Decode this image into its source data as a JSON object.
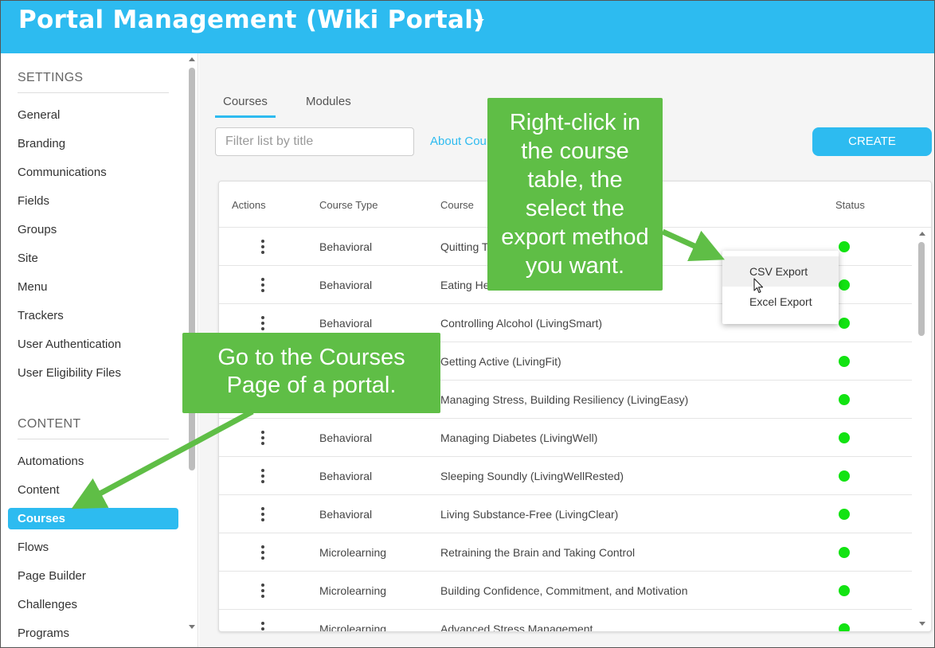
{
  "header": {
    "title": "Portal Management (Wiki Portal)",
    "bg_color": "#2dbbf0"
  },
  "sidebar": {
    "settings_heading": "SETTINGS",
    "settings_items": [
      {
        "label": "General"
      },
      {
        "label": "Branding"
      },
      {
        "label": "Communications"
      },
      {
        "label": "Fields"
      },
      {
        "label": "Groups"
      },
      {
        "label": "Site"
      },
      {
        "label": "Menu"
      },
      {
        "label": "Trackers"
      },
      {
        "label": "User Authentication"
      },
      {
        "label": "User Eligibility Files"
      }
    ],
    "content_heading": "CONTENT",
    "content_items": [
      {
        "label": "Automations"
      },
      {
        "label": "Content"
      },
      {
        "label": "Courses",
        "active": true
      },
      {
        "label": "Flows"
      },
      {
        "label": "Page Builder"
      },
      {
        "label": "Challenges"
      },
      {
        "label": "Programs"
      }
    ]
  },
  "main": {
    "tabs": [
      {
        "label": "Courses",
        "active": true
      },
      {
        "label": "Modules"
      }
    ],
    "filter": {
      "placeholder": "Filter list by title"
    },
    "about_link": "About Cou",
    "create_label": "CREATE"
  },
  "table": {
    "headers": {
      "actions": "Actions",
      "course_type": "Course Type",
      "course": "Course",
      "status": "Status"
    },
    "rows": [
      {
        "type": "Behavioral",
        "course": "Quitting T",
        "status_color": "#12e312"
      },
      {
        "type": "Behavioral",
        "course": "Eating He",
        "status_color": "#12e312"
      },
      {
        "type": "Behavioral",
        "course": "Controlling Alcohol (LivingSmart)",
        "status_color": "#12e312"
      },
      {
        "type": "",
        "course": "Getting Active (LivingFit)",
        "status_color": "#12e312"
      },
      {
        "type": "",
        "course": "Managing Stress, Building Resiliency (LivingEasy)",
        "status_color": "#12e312"
      },
      {
        "type": "Behavioral",
        "course": "Managing Diabetes (LivingWell)",
        "status_color": "#12e312"
      },
      {
        "type": "Behavioral",
        "course": "Sleeping Soundly (LivingWellRested)",
        "status_color": "#12e312"
      },
      {
        "type": "Behavioral",
        "course": "Living Substance-Free (LivingClear)",
        "status_color": "#12e312"
      },
      {
        "type": "Microlearning",
        "course": "Retraining the Brain and Taking Control",
        "status_color": "#12e312"
      },
      {
        "type": "Microlearning",
        "course": "Building Confidence, Commitment, and Motivation",
        "status_color": "#12e312"
      },
      {
        "type": "Microlearning",
        "course": "Advanced Stress Management",
        "status_color": "#12e312"
      }
    ]
  },
  "context_menu": {
    "items": [
      {
        "label": "CSV Export"
      },
      {
        "label": "Excel Export"
      }
    ]
  },
  "callouts": {
    "export_lines": [
      "Right-click in",
      "the course",
      "table, the",
      "select the",
      "export method",
      "you want."
    ],
    "courses_lines": [
      "Go to the Courses",
      "Page of a portal."
    ],
    "color": "#5fbe46"
  }
}
